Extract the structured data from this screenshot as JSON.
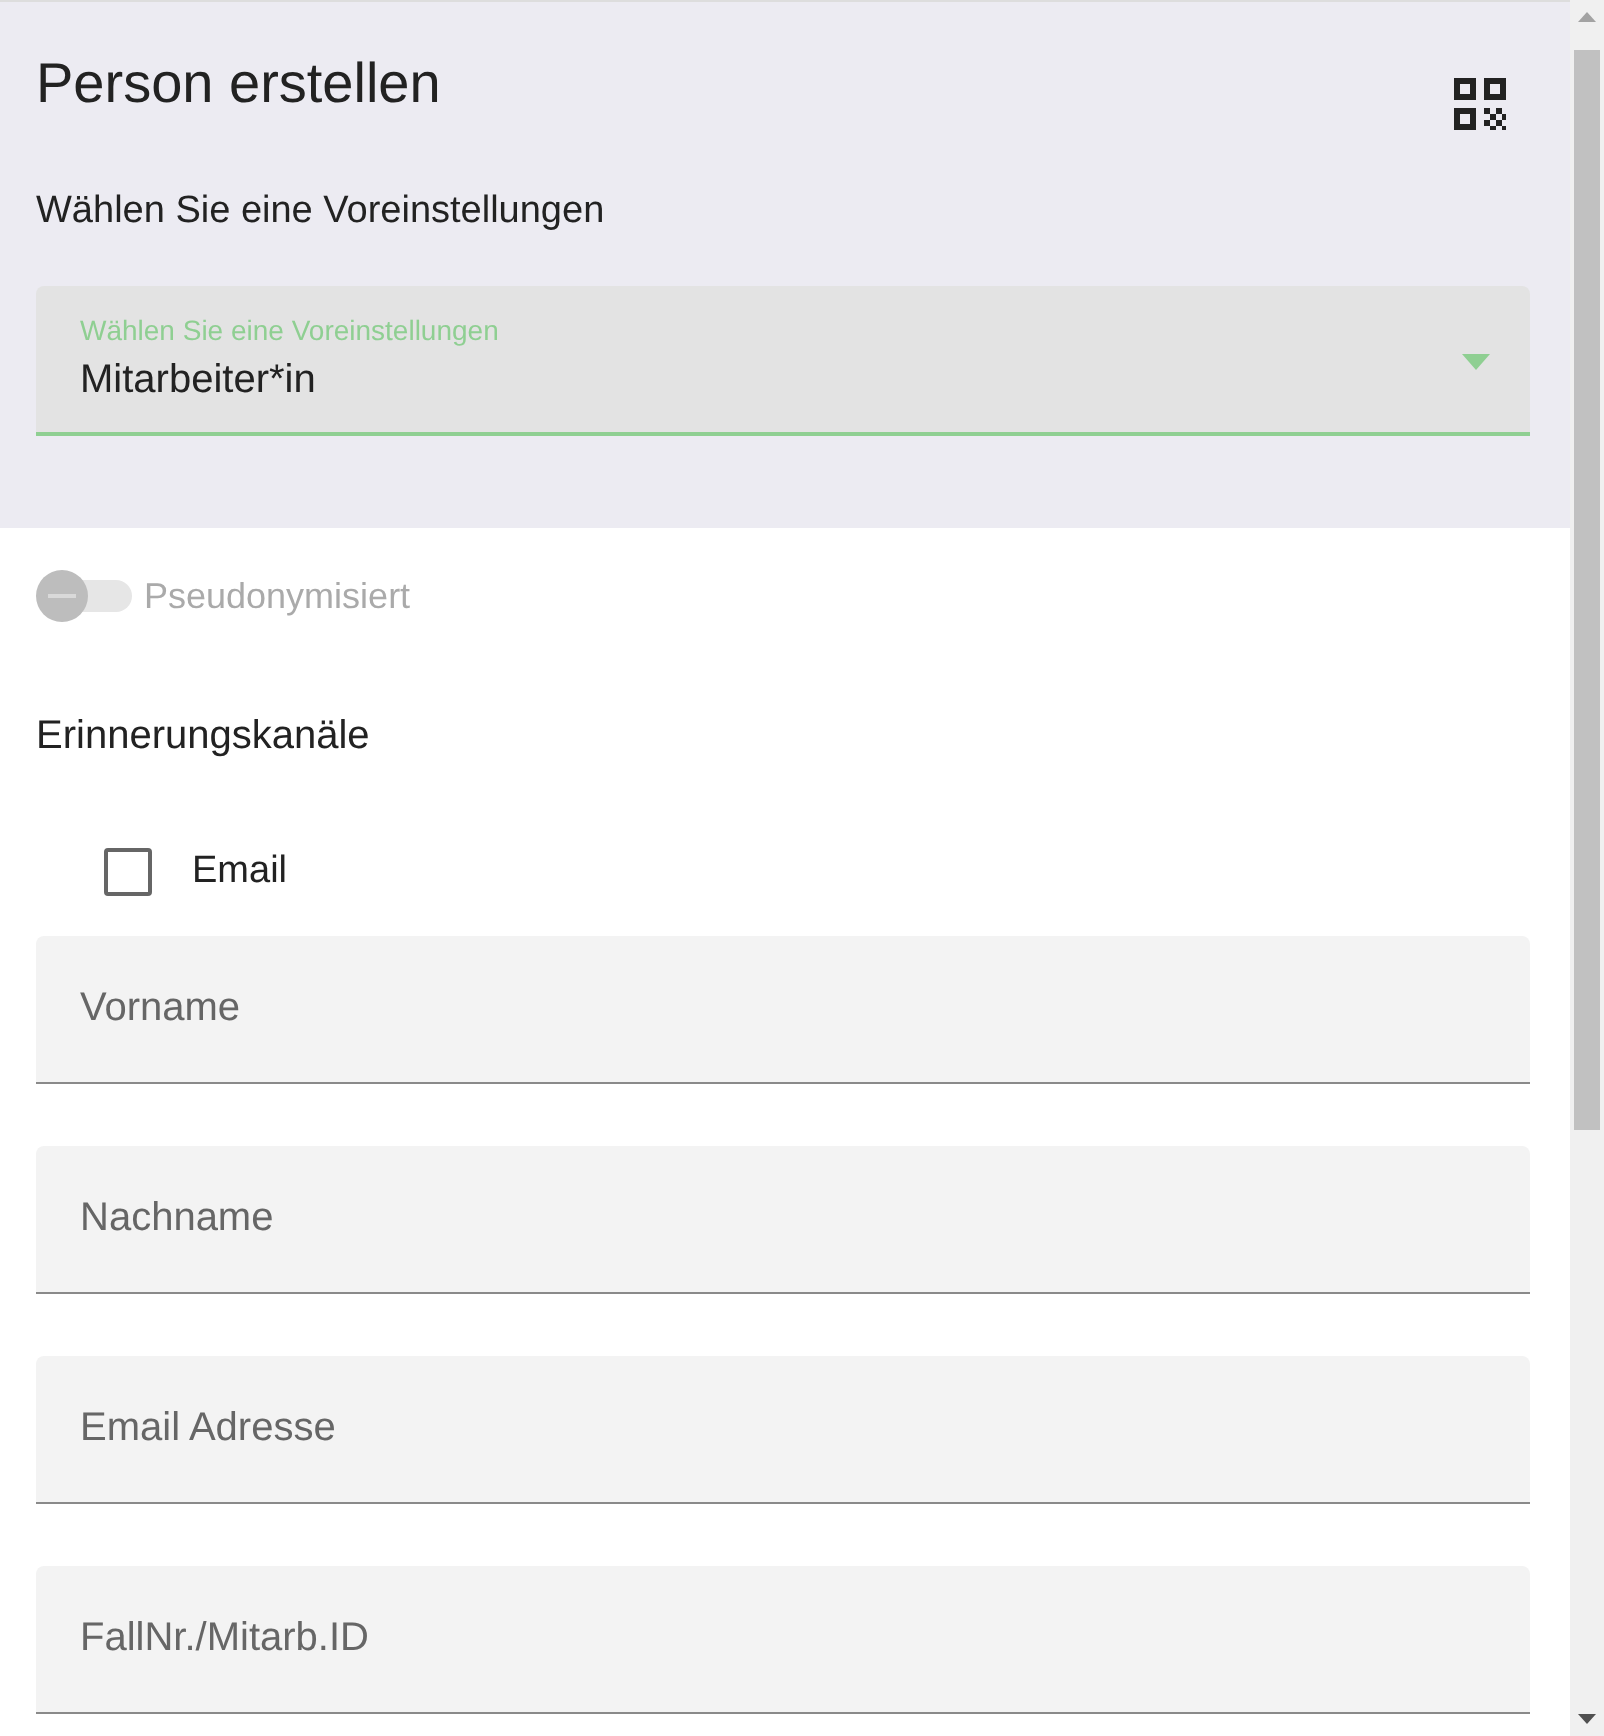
{
  "header": {
    "title": "Person erstellen",
    "subtitle": "Wählen Sie eine Voreinstellungen",
    "preset_select": {
      "label": "Wählen Sie eine Voreinstellungen",
      "value": "Mitarbeiter*in"
    }
  },
  "pseudonym_toggle": {
    "label": "Pseudonymisiert",
    "on": false,
    "disabled": true
  },
  "reminder_channels": {
    "title": "Erinnerungskanäle",
    "options": [
      {
        "label": "Email",
        "checked": false
      }
    ]
  },
  "fields": [
    {
      "placeholder": "Vorname"
    },
    {
      "placeholder": "Nachname"
    },
    {
      "placeholder": "Email Adresse"
    },
    {
      "placeholder": "FallNr./Mitarb.ID"
    }
  ]
}
